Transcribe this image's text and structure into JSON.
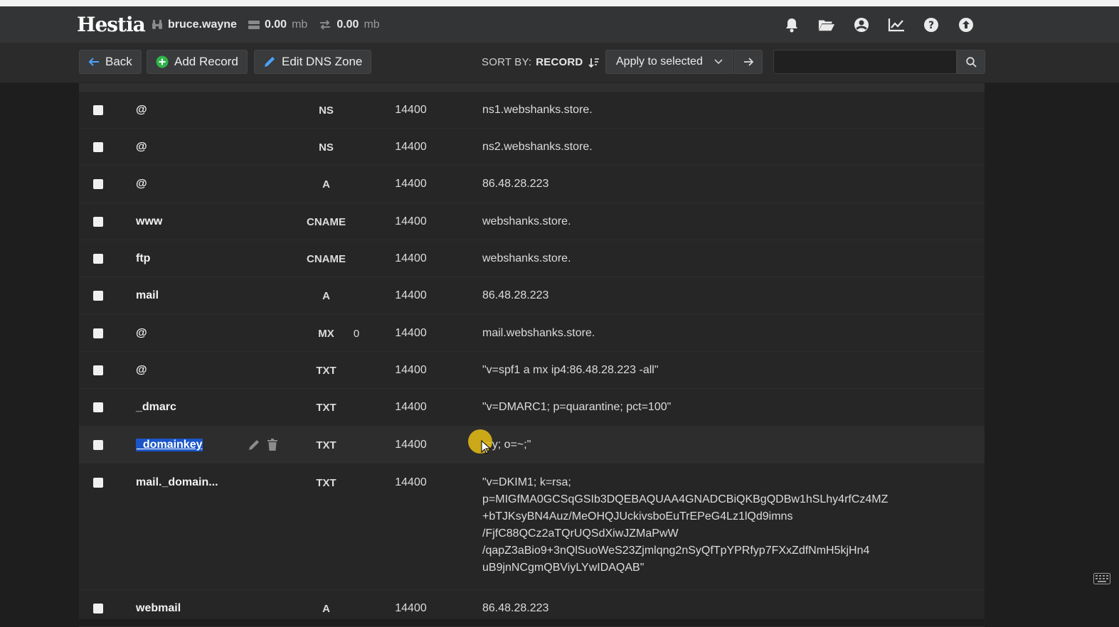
{
  "app": {
    "logo": "Hestia"
  },
  "header": {
    "username": "bruce.wayne",
    "disk_value": "0.00",
    "disk_unit": "mb",
    "bandwidth_value": "0.00",
    "bandwidth_unit": "mb",
    "icons": [
      "bell-icon",
      "folder-open-icon",
      "user-circle-icon",
      "chart-line-icon",
      "help-icon",
      "upload-icon"
    ]
  },
  "toolbar": {
    "back_label": "Back",
    "add_record_label": "Add Record",
    "edit_zone_label": "Edit DNS Zone",
    "sort_by_label": "SORT BY:",
    "sort_field": "RECORD",
    "apply_label": "Apply to selected",
    "search_placeholder": ""
  },
  "records": [
    {
      "record": "@",
      "type": "NS",
      "priority": "",
      "ttl": "14400",
      "value": "ns1.webshanks.store."
    },
    {
      "record": "@",
      "type": "NS",
      "priority": "",
      "ttl": "14400",
      "value": "ns2.webshanks.store."
    },
    {
      "record": "@",
      "type": "A",
      "priority": "",
      "ttl": "14400",
      "value": "86.48.28.223"
    },
    {
      "record": "www",
      "type": "CNAME",
      "priority": "",
      "ttl": "14400",
      "value": "webshanks.store."
    },
    {
      "record": "ftp",
      "type": "CNAME",
      "priority": "",
      "ttl": "14400",
      "value": "webshanks.store."
    },
    {
      "record": "mail",
      "type": "A",
      "priority": "",
      "ttl": "14400",
      "value": "86.48.28.223"
    },
    {
      "record": "@",
      "type": "MX",
      "priority": "0",
      "ttl": "14400",
      "value": "mail.webshanks.store."
    },
    {
      "record": "@",
      "type": "TXT",
      "priority": "",
      "ttl": "14400",
      "value": "\"v=spf1 a mx ip4:86.48.28.223 -all\""
    },
    {
      "record": "_dmarc",
      "type": "TXT",
      "priority": "",
      "ttl": "14400",
      "value": "\"v=DMARC1; p=quarantine; pct=100\""
    },
    {
      "record": "_domainkey",
      "type": "TXT",
      "priority": "",
      "ttl": "14400",
      "value": "t=y; o=~;\""
    },
    {
      "record": "mail._domain...",
      "type": "TXT",
      "priority": "",
      "ttl": "14400",
      "value_lines": [
        "\"v=DKIM1; k=rsa;",
        "p=MIGfMA0GCSqGSIb3DQEBAQUAA4GNADCBiQKBgQDBw1hSLhy4rfCz4MZ",
        "+bTJKsyBN4Auz/MeOHQJUckivsboEuTrEPeG4Lz1lQd9imns",
        "/FjfC88QCz2aTQrUQSdXiwJZMaPwW",
        "/qapZ3aBio9+3nQlSuoWeS23Zjmlqng2nSyQfTpYPRfyp7FXxZdfNmH5kjHn4",
        "uB9jnNCgmQBViyLYwIDAQAB\""
      ]
    },
    {
      "record": "webmail",
      "type": "A",
      "priority": "",
      "ttl": "14400",
      "value": "86.48.28.223"
    }
  ]
}
